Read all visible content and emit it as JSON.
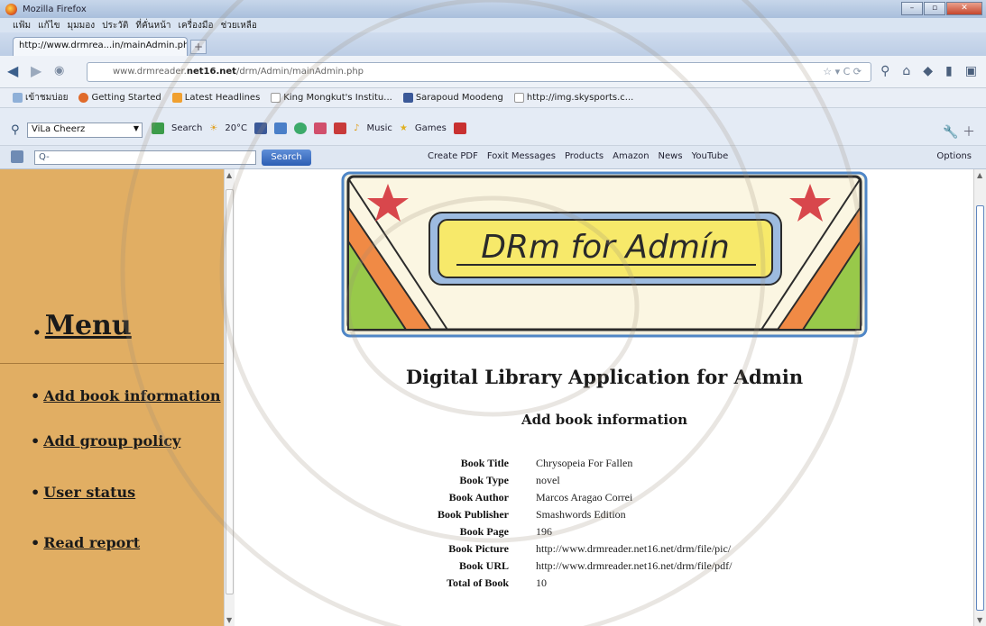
{
  "window": {
    "title": "Mozilla Firefox"
  },
  "menubar": [
    "แฟ้ม",
    "แก้ไข",
    "มุมมอง",
    "ประวัติ",
    "ที่คั่นหน้า",
    "เครื่องมือ",
    "ช่วยเหลือ"
  ],
  "tab": {
    "label": "http://www.drmrea...in/mainAdmin.php",
    "new_tab": "+"
  },
  "urlbar": {
    "prefix": "www.drmreader.",
    "domain": "net16.net",
    "path": "/drm/Admin/mainAdmin.php"
  },
  "bookmarks": [
    "เข้าชมบ่อย",
    "Getting Started",
    "Latest Headlines",
    "King Mongkut's Institu...",
    "Sarapoud Moodeng",
    "http://img.skysports.c..."
  ],
  "toolbar": {
    "profile": "ViLa Cheerz",
    "search_label": "Search",
    "weather": "20°C",
    "music": "Music",
    "games": "Games"
  },
  "toolbar2": {
    "search_placeholder": "Q-",
    "search_button": "Search",
    "links": [
      "Create PDF",
      "Foxit Messages",
      "Products",
      "Amazon",
      "News",
      "YouTube"
    ],
    "options": "Options"
  },
  "banner": {
    "text": "DRm for Admín"
  },
  "sidebar": {
    "heading": "Menu",
    "items": [
      "Add book information",
      "Add group policy",
      "User status",
      "Read report"
    ]
  },
  "main": {
    "title": "Digital Library Application for Admin",
    "section": "Add book information",
    "fields": [
      {
        "label": "Book Title",
        "value": "Chrysopeia For Fallen"
      },
      {
        "label": "Book Type",
        "value": "novel"
      },
      {
        "label": "Book Author",
        "value": "Marcos Aragao Correi"
      },
      {
        "label": "Book Publisher",
        "value": "Smashwords Edition"
      },
      {
        "label": "Book Page",
        "value": "196"
      },
      {
        "label": "Book Picture",
        "value": "http://www.drmreader.net16.net/drm/file/pic/"
      },
      {
        "label": "Book URL",
        "value": "http://www.drmreader.net16.net/drm/file/pdf/"
      },
      {
        "label": "Total of Book",
        "value": "10"
      }
    ]
  },
  "colors": {
    "sidebar_bg": "#e1ae63",
    "banner_plate": "#f7e96a",
    "banner_frame": "#8fb3d9",
    "stripe_orange": "#f08a45",
    "stripe_green": "#98c94a",
    "star_red": "#d8474c"
  }
}
